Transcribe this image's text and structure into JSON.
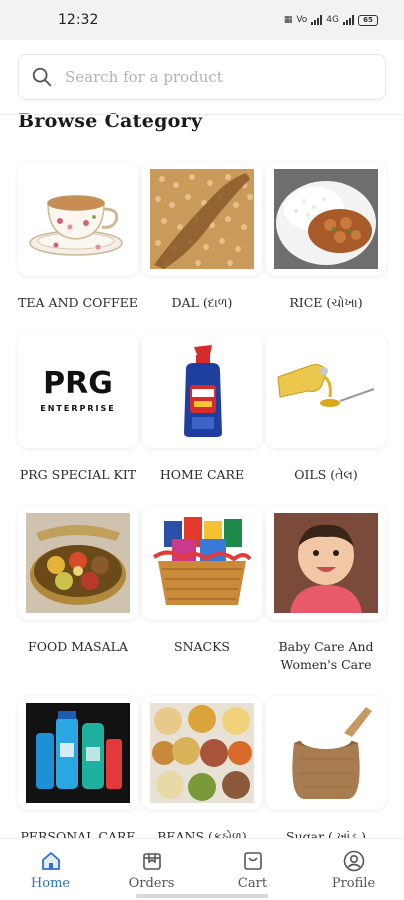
{
  "status_bar": {
    "time": "12:32",
    "battery": "65"
  },
  "search": {
    "placeholder": "Search for a product"
  },
  "section": {
    "title": "Browse Category"
  },
  "categories": [
    {
      "label": "TEA AND COFFEE",
      "icon": "tea-cup-image"
    },
    {
      "label": "DAL (દાળ)",
      "icon": "dal-grains-image"
    },
    {
      "label": "RICE (ચોખા)",
      "icon": "rice-curry-image"
    },
    {
      "label": "PRG SPECIAL KIT",
      "icon": "prg-logo-image",
      "logo_text": "PRG",
      "logo_subtext": "ENTERPRISE"
    },
    {
      "label": "HOME CARE",
      "icon": "toilet-cleaner-image"
    },
    {
      "label": "OILS (તેલ)",
      "icon": "oil-pour-image"
    },
    {
      "label": "FOOD MASALA",
      "icon": "masala-box-image"
    },
    {
      "label": "SNACKS",
      "icon": "snack-basket-image"
    },
    {
      "label": "Baby Care And Women's Care",
      "icon": "baby-image"
    },
    {
      "label": "PERSONAL CARE",
      "icon": "mouthwash-image"
    },
    {
      "label": "BEANS (કઠોળ)",
      "icon": "beans-bowls-image"
    },
    {
      "label": "Sugar ( ખાંડ )",
      "icon": "sugar-sack-image"
    }
  ],
  "bottom_nav": {
    "items": [
      {
        "label": "Home",
        "icon": "home-icon",
        "active": true
      },
      {
        "label": "Orders",
        "icon": "orders-icon",
        "active": false
      },
      {
        "label": "Cart",
        "icon": "cart-icon",
        "active": false
      },
      {
        "label": "Profile",
        "icon": "profile-icon",
        "active": false
      }
    ]
  },
  "colors": {
    "accent": "#2e6fd1",
    "text": "#2a2a2a",
    "muted": "#b3b3b3"
  }
}
